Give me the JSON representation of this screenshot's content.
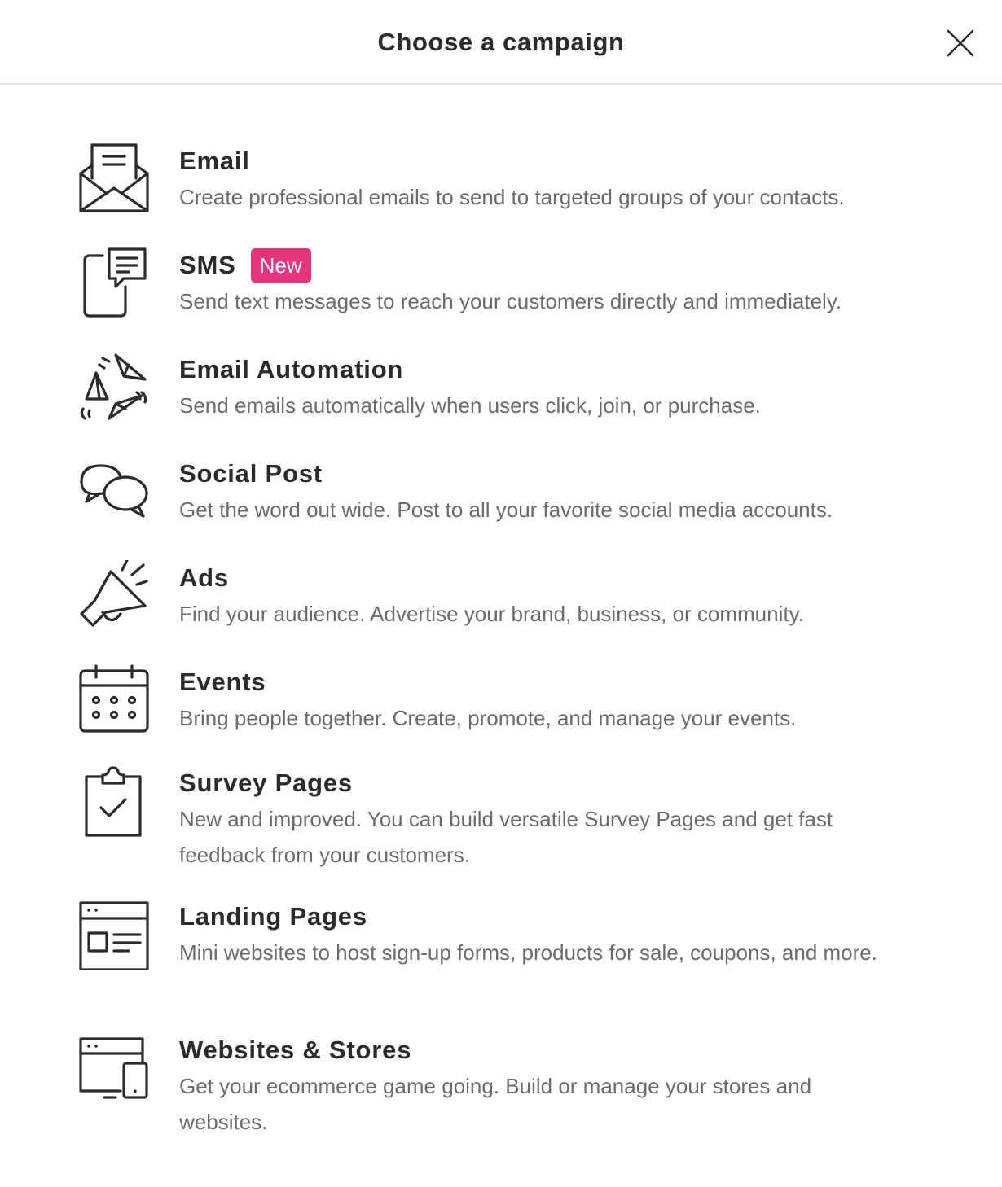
{
  "header": {
    "title": "Choose a campaign",
    "close_icon": "close-icon"
  },
  "colors": {
    "badge": "#e8327c",
    "title": "#2b2b2b",
    "description": "#6b6b6b",
    "divider": "#e3e3e3"
  },
  "campaigns": [
    {
      "title": "Email",
      "description": "Create professional emails to send to targeted groups of your contacts.",
      "icon": "envelope-icon"
    },
    {
      "title": "SMS",
      "badge": "New",
      "description": "Send text messages to reach your customers directly and immediately.",
      "icon": "phone-message-icon"
    },
    {
      "title": "Email Automation",
      "description": "Send emails automatically when users click, join, or purchase.",
      "icon": "paper-planes-icon"
    },
    {
      "title": "Social Post",
      "description": "Get the word out wide. Post to all your favorite social media accounts.",
      "icon": "chat-bubbles-icon"
    },
    {
      "title": "Ads",
      "description": "Find your audience. Advertise your brand, business, or community.",
      "icon": "megaphone-icon"
    },
    {
      "title": "Events",
      "description": "Bring people together. Create, promote, and manage your events.",
      "icon": "calendar-icon"
    },
    {
      "title": "Survey Pages",
      "description": "New and improved. You can build versatile Survey Pages and get fast feedback from your customers.",
      "icon": "clipboard-check-icon"
    },
    {
      "title": "Landing Pages",
      "description": "Mini websites to host sign-up forms, products for sale, coupons, and more.",
      "icon": "landing-page-icon"
    },
    {
      "title": "Websites & Stores",
      "description": "Get your ecommerce game going. Build or manage your stores and websites.",
      "icon": "devices-icon"
    }
  ]
}
